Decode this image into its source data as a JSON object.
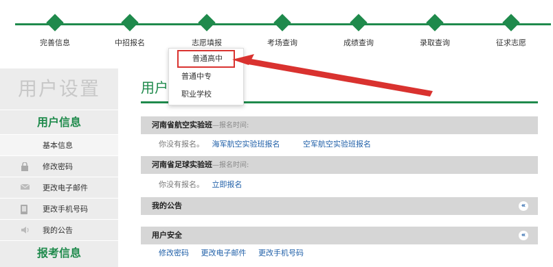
{
  "steps": [
    {
      "label": "完善信息"
    },
    {
      "label": "中招报名"
    },
    {
      "label": "志愿填报"
    },
    {
      "label": "考场查询"
    },
    {
      "label": "成绩查询"
    },
    {
      "label": "录取查询"
    },
    {
      "label": "征求志愿"
    }
  ],
  "dropdown": {
    "items": [
      "普通高中",
      "普通中专",
      "职业学校"
    ]
  },
  "sidebar": {
    "title": "用户设置",
    "section_user": "用户信息",
    "items": [
      {
        "label": "基本信息",
        "icon": ""
      },
      {
        "label": "修改密码",
        "icon": "lock-icon"
      },
      {
        "label": "更改电子邮件",
        "icon": "mail-icon"
      },
      {
        "label": "更改手机号码",
        "icon": "phone-icon"
      },
      {
        "label": "我的公告",
        "icon": "speaker-icon"
      }
    ],
    "section_exam": "报考信息"
  },
  "main": {
    "title": "用户",
    "panels": {
      "aviation": {
        "title": "河南省航空实验班",
        "sub": "—报名时间:",
        "muted": "你没有报名。",
        "link1": "海军航空实验班报名",
        "link2": "空军航空实验班报名"
      },
      "football": {
        "title": "河南省足球实验班",
        "sub": "—报名时间:",
        "muted": "你没有报名。",
        "link1": "立即报名"
      },
      "notice": {
        "title": "我的公告",
        "collapse": "«"
      },
      "security": {
        "title": "用户安全",
        "collapse": "«",
        "links": [
          "修改密码",
          "更改电子邮件",
          "更改手机号码"
        ]
      }
    }
  },
  "colors": {
    "accent": "#1f8a4c",
    "link": "#1f5fa8",
    "highlight": "#d9322f"
  }
}
